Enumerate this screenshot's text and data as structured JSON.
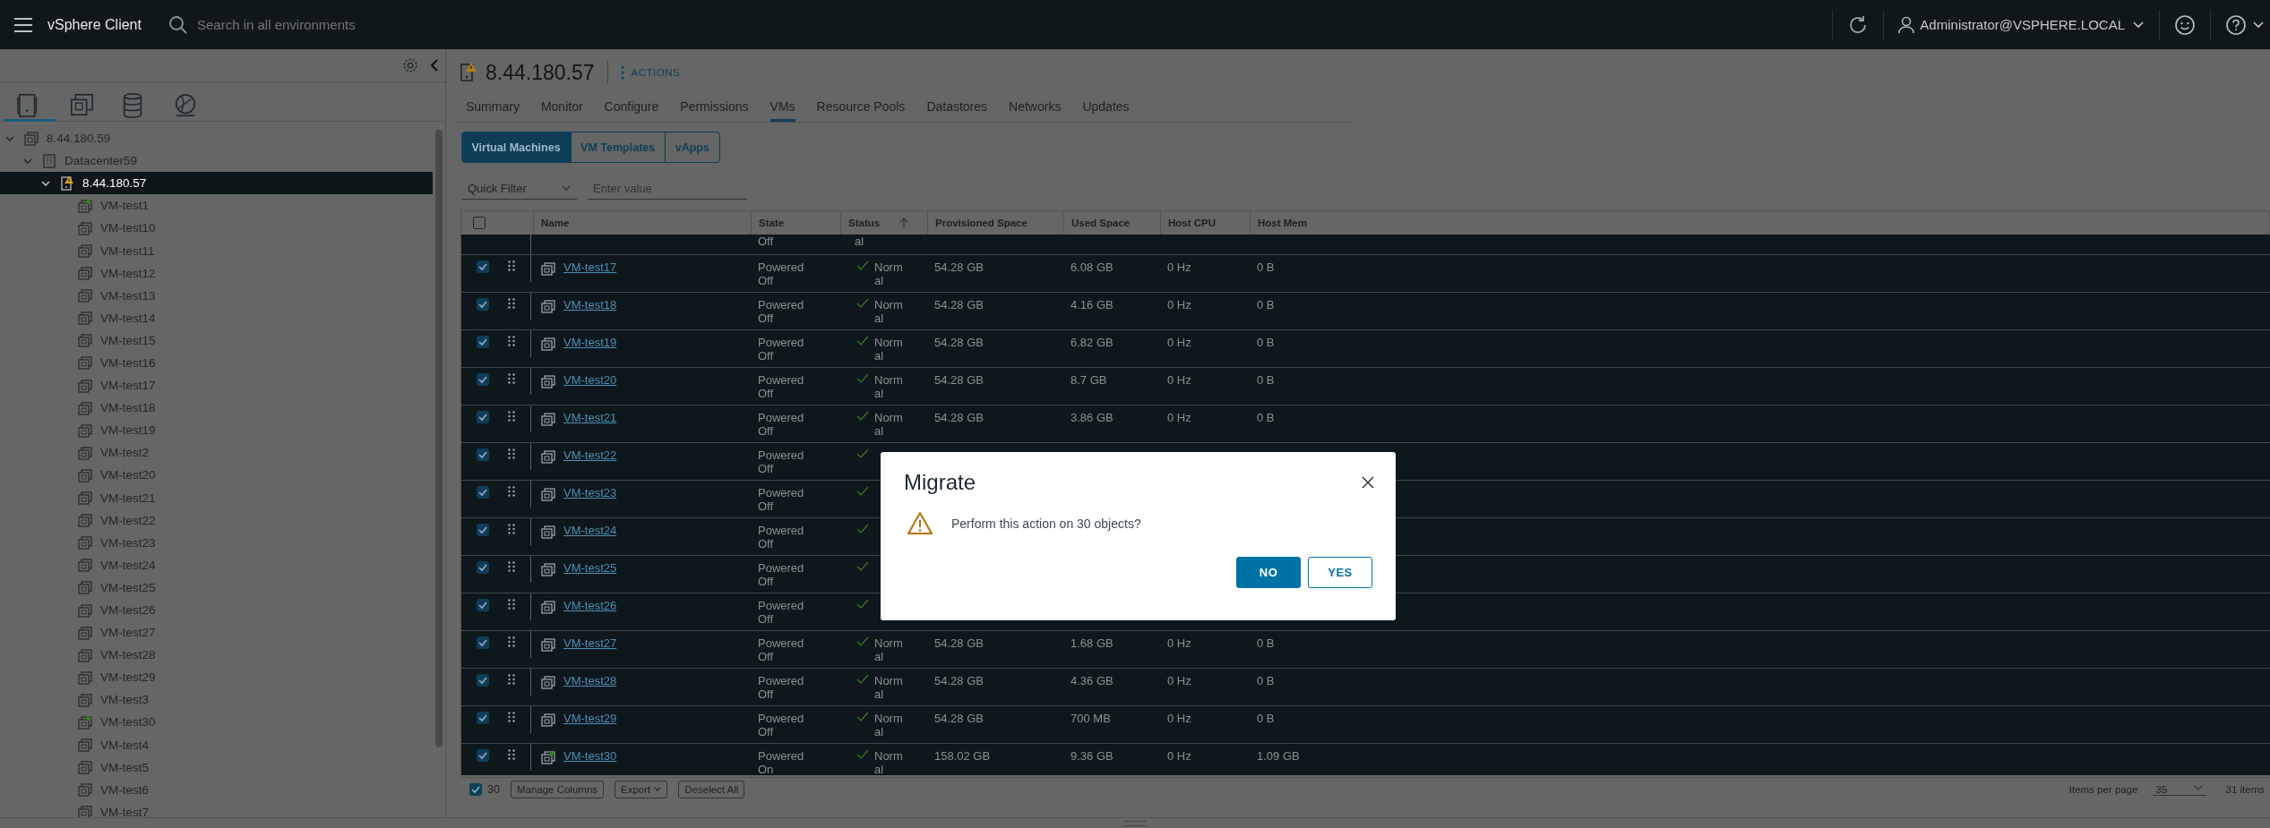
{
  "header": {
    "app_title": "vSphere Client",
    "search": {
      "placeholder": "Search in all environments"
    },
    "user": "Administrator@VSPHERE.LOCAL"
  },
  "sidebar": {
    "view_tabs": [
      {
        "kind": "hosts",
        "selected": true
      },
      {
        "kind": "vms",
        "selected": false
      },
      {
        "kind": "storage",
        "selected": false
      },
      {
        "kind": "network",
        "selected": false
      }
    ],
    "tree": [
      {
        "label": "8.44.180.59",
        "kind": "vcenter",
        "expanded": true,
        "selected": false,
        "children": [
          {
            "label": "Datacenter59",
            "kind": "datacenter",
            "expanded": true,
            "selected": false,
            "children": [
              {
                "label": "8.44.180.57",
                "kind": "host",
                "expanded": true,
                "selected": true,
                "children": [
                  {
                    "label": "VM-test1",
                    "kind": "vm",
                    "powered_on": true,
                    "selected": false
                  },
                  {
                    "label": "VM-test10",
                    "kind": "vm",
                    "powered_on": false,
                    "selected": false
                  },
                  {
                    "label": "VM-test11",
                    "kind": "vm",
                    "powered_on": false,
                    "selected": false
                  },
                  {
                    "label": "VM-test12",
                    "kind": "vm",
                    "powered_on": false,
                    "selected": false
                  },
                  {
                    "label": "VM-test13",
                    "kind": "vm",
                    "powered_on": false,
                    "selected": false
                  },
                  {
                    "label": "VM-test14",
                    "kind": "vm",
                    "powered_on": false,
                    "selected": false
                  },
                  {
                    "label": "VM-test15",
                    "kind": "vm",
                    "powered_on": false,
                    "selected": false
                  },
                  {
                    "label": "VM-test16",
                    "kind": "vm",
                    "powered_on": false,
                    "selected": false
                  },
                  {
                    "label": "VM-test17",
                    "kind": "vm",
                    "powered_on": false,
                    "selected": false
                  },
                  {
                    "label": "VM-test18",
                    "kind": "vm",
                    "powered_on": false,
                    "selected": false
                  },
                  {
                    "label": "VM-test19",
                    "kind": "vm",
                    "powered_on": false,
                    "selected": false
                  },
                  {
                    "label": "VM-test2",
                    "kind": "vm",
                    "powered_on": false,
                    "selected": false
                  },
                  {
                    "label": "VM-test20",
                    "kind": "vm",
                    "powered_on": false,
                    "selected": false
                  },
                  {
                    "label": "VM-test21",
                    "kind": "vm",
                    "powered_on": false,
                    "selected": false
                  },
                  {
                    "label": "VM-test22",
                    "kind": "vm",
                    "powered_on": false,
                    "selected": false
                  },
                  {
                    "label": "VM-test23",
                    "kind": "vm",
                    "powered_on": false,
                    "selected": false
                  },
                  {
                    "label": "VM-test24",
                    "kind": "vm",
                    "powered_on": false,
                    "selected": false
                  },
                  {
                    "label": "VM-test25",
                    "kind": "vm",
                    "powered_on": false,
                    "selected": false
                  },
                  {
                    "label": "VM-test26",
                    "kind": "vm",
                    "powered_on": false,
                    "selected": false
                  },
                  {
                    "label": "VM-test27",
                    "kind": "vm",
                    "powered_on": false,
                    "selected": false
                  },
                  {
                    "label": "VM-test28",
                    "kind": "vm",
                    "powered_on": false,
                    "selected": false
                  },
                  {
                    "label": "VM-test29",
                    "kind": "vm",
                    "powered_on": false,
                    "selected": false
                  },
                  {
                    "label": "VM-test3",
                    "kind": "vm",
                    "powered_on": false,
                    "selected": false
                  },
                  {
                    "label": "VM-test30",
                    "kind": "vm",
                    "powered_on": true,
                    "selected": false
                  },
                  {
                    "label": "VM-test4",
                    "kind": "vm",
                    "powered_on": false,
                    "selected": false
                  },
                  {
                    "label": "VM-test5",
                    "kind": "vm",
                    "powered_on": false,
                    "selected": false
                  },
                  {
                    "label": "VM-test6",
                    "kind": "vm",
                    "powered_on": false,
                    "selected": false
                  },
                  {
                    "label": "VM-test7",
                    "kind": "vm",
                    "powered_on": false,
                    "selected": false
                  }
                ]
              }
            ]
          }
        ]
      }
    ]
  },
  "object": {
    "title": "8.44.180.57",
    "actions": "ACTIONS",
    "tabs": [
      {
        "label": "Summary",
        "selected": false
      },
      {
        "label": "Monitor",
        "selected": false
      },
      {
        "label": "Configure",
        "selected": false
      },
      {
        "label": "Permissions",
        "selected": false
      },
      {
        "label": "VMs",
        "selected": true
      },
      {
        "label": "Resource Pools",
        "selected": false
      },
      {
        "label": "Datastores",
        "selected": false
      },
      {
        "label": "Networks",
        "selected": false
      },
      {
        "label": "Updates",
        "selected": false
      }
    ],
    "subtabs": [
      {
        "label": "Virtual Machines",
        "selected": true
      },
      {
        "label": "VM Templates",
        "selected": false
      },
      {
        "label": "vApps",
        "selected": false
      }
    ],
    "filter": {
      "quick_filter": "Quick Filter",
      "placeholder": "Enter value"
    }
  },
  "table": {
    "select_all_checked": false,
    "columns": [
      "Name",
      "State",
      "Status",
      "Provisioned Space",
      "Used Space",
      "Host CPU",
      "Host Mem"
    ],
    "partial_row": {
      "state": "Off",
      "status": "al"
    },
    "rows": [
      {
        "name": "VM-test17",
        "powered_on": false,
        "checked": true,
        "state": "Powered Off",
        "status": "Normal",
        "provisioned": "54.28 GB",
        "used": "6.08 GB",
        "cpu": "0 Hz",
        "mem": "0 B"
      },
      {
        "name": "VM-test18",
        "powered_on": false,
        "checked": true,
        "state": "Powered Off",
        "status": "Normal",
        "provisioned": "54.28 GB",
        "used": "4.16 GB",
        "cpu": "0 Hz",
        "mem": "0 B"
      },
      {
        "name": "VM-test19",
        "powered_on": false,
        "checked": true,
        "state": "Powered Off",
        "status": "Normal",
        "provisioned": "54.28 GB",
        "used": "6.82 GB",
        "cpu": "0 Hz",
        "mem": "0 B"
      },
      {
        "name": "VM-test20",
        "powered_on": false,
        "checked": true,
        "state": "Powered Off",
        "status": "Normal",
        "provisioned": "54.28 GB",
        "used": "8.7 GB",
        "cpu": "0 Hz",
        "mem": "0 B"
      },
      {
        "name": "VM-test21",
        "powered_on": false,
        "checked": true,
        "state": "Powered Off",
        "status": "Normal",
        "provisioned": "54.28 GB",
        "used": "3.86 GB",
        "cpu": "0 Hz",
        "mem": "0 B"
      },
      {
        "name": "VM-test22",
        "powered_on": false,
        "checked": true,
        "state": "Powered Off"
      },
      {
        "name": "VM-test23",
        "powered_on": false,
        "checked": true,
        "state": "Powered Off"
      },
      {
        "name": "VM-test24",
        "powered_on": false,
        "checked": true,
        "state": "Powered Off"
      },
      {
        "name": "VM-test25",
        "powered_on": false,
        "checked": true,
        "state": "Powered Off"
      },
      {
        "name": "VM-test26",
        "powered_on": false,
        "checked": true,
        "state": "Powered Off"
      },
      {
        "name": "VM-test27",
        "powered_on": false,
        "checked": true,
        "state": "Powered Off",
        "status": "Normal",
        "provisioned": "54.28 GB",
        "used": "1.68 GB",
        "cpu": "0 Hz",
        "mem": "0 B"
      },
      {
        "name": "VM-test28",
        "powered_on": false,
        "checked": true,
        "state": "Powered Off",
        "status": "Normal",
        "provisioned": "54.28 GB",
        "used": "4.36 GB",
        "cpu": "0 Hz",
        "mem": "0 B"
      },
      {
        "name": "VM-test29",
        "powered_on": false,
        "checked": true,
        "state": "Powered Off",
        "status": "Normal",
        "provisioned": "54.28 GB",
        "used": "700 MB",
        "cpu": "0 Hz",
        "mem": "0 B"
      },
      {
        "name": "VM-test30",
        "powered_on": true,
        "checked": true,
        "state": "Powered On",
        "status": "Normal",
        "provisioned": "158.02 GB",
        "used": "9.36 GB",
        "cpu": "0 Hz",
        "mem": "1.09 GB"
      }
    ],
    "footer": {
      "checked": true,
      "count": "30",
      "buttons": [
        {
          "label": "Manage Columns",
          "kind": "plain"
        },
        {
          "label": "Export",
          "kind": "menu"
        },
        {
          "label": "Deselect All",
          "kind": "plain"
        }
      ],
      "per_page_label": "Items per page",
      "per_page": "35",
      "total": "31 items"
    }
  },
  "dialog": {
    "title": "Migrate",
    "message": "Perform this action on 30 objects?",
    "buttons": [
      {
        "label": "NO",
        "primary": true
      },
      {
        "label": "YES",
        "primary": false
      }
    ]
  }
}
